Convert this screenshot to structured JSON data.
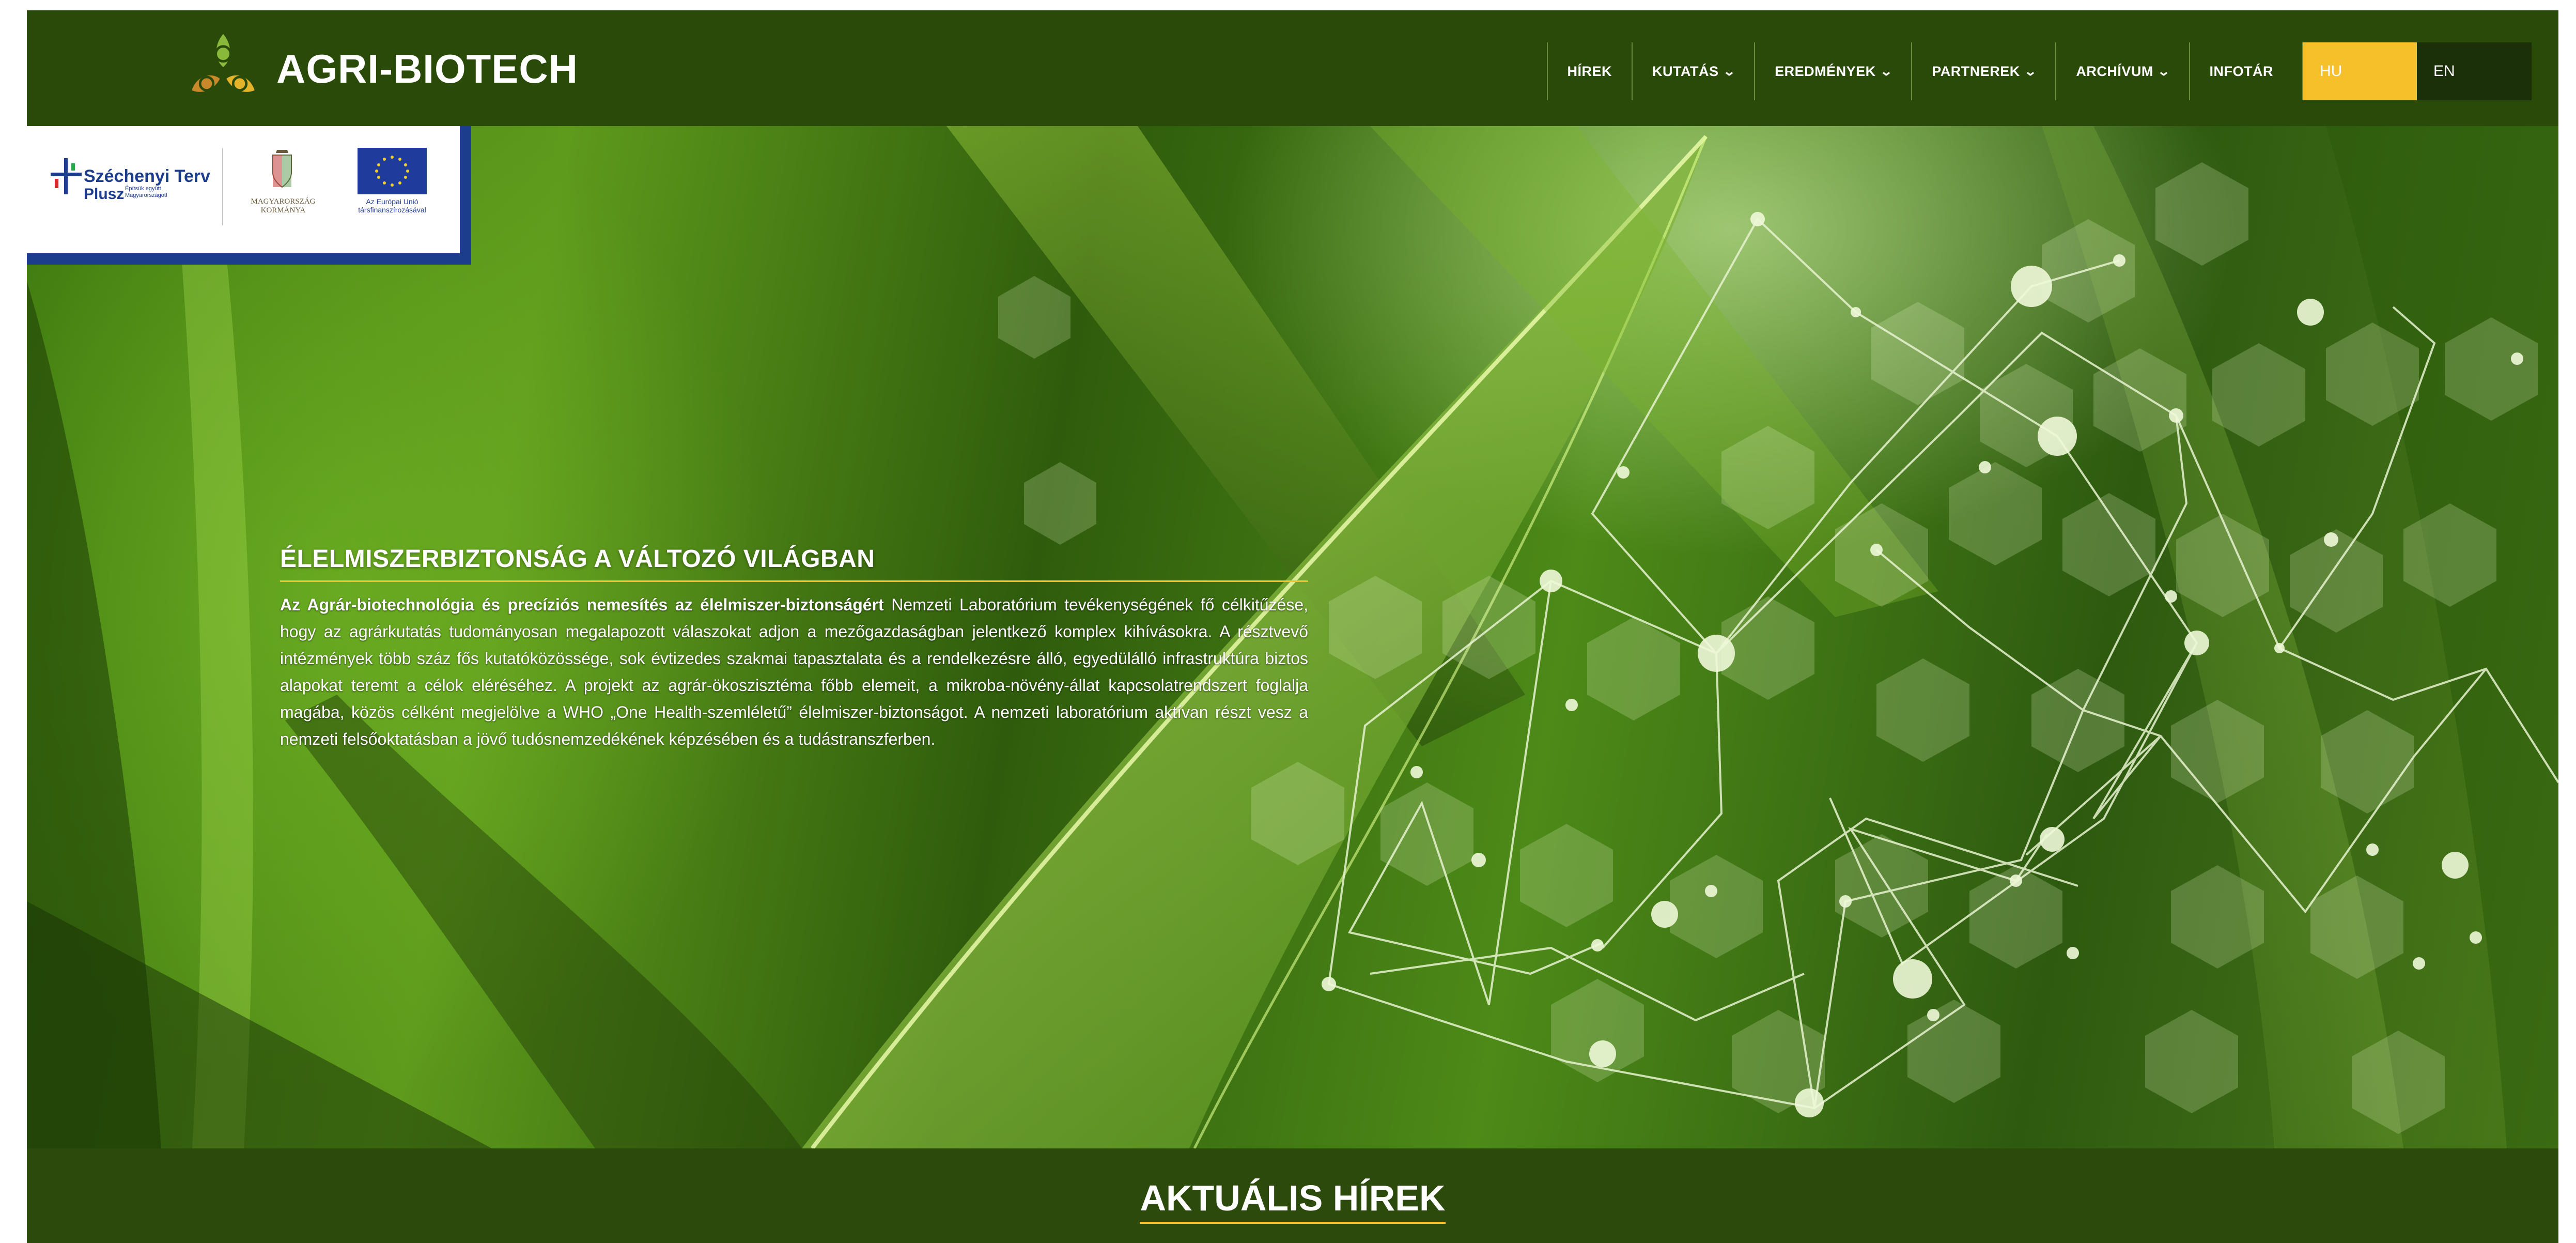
{
  "brand": {
    "name": "AGRI-BIOTECH",
    "logo_icon": "leaf-spiral-logo"
  },
  "nav": {
    "items": [
      {
        "label": "HÍREK",
        "has_dropdown": false
      },
      {
        "label": "KUTATÁS",
        "has_dropdown": true
      },
      {
        "label": "EREDMÉNYEK",
        "has_dropdown": true
      },
      {
        "label": "PARTNEREK",
        "has_dropdown": true
      },
      {
        "label": "ARCHÍVUM",
        "has_dropdown": true
      },
      {
        "label": "INFOTÁR",
        "has_dropdown": false
      }
    ],
    "lang_hu": "HU",
    "lang_en": "EN",
    "active_lang_color": "#f5c02a"
  },
  "funding_badge": {
    "szechenyi_title": "Széchenyi Terv",
    "szechenyi_sub": "Plusz",
    "szechenyi_tiny": "Építsük együtt Magyarországot!",
    "gov_text": "MAGYARORSZÁG KORMÁNYA",
    "eu_text": "Az Európai Unió társfinanszírozásával"
  },
  "intro": {
    "title": "ÉLELMISZERBIZTONSÁG A VÁLTOZÓ VILÁGBAN",
    "lead": "Az Agrár-biotechnológia és precíziós nemesítés az élelmiszer-biztonságért",
    "body": " Nemzeti Laboratórium tevékenységének fő célkitűzése, hogy az agrárkutatás tudományosan megalapozott válaszokat adjon a mezőgazdaságban jelentkező komplex kihívásokra. A résztvevő intézmények több száz fős kutatóközössége, sok évtizedes szakmai tapasztalata és a rendelkezésre álló, egyedülálló infrastruktúra biztos alapokat teremt a célok eléréséhez. A projekt az agrár-ökoszisztéma főbb elemeit, a mikroba-növény-állat kapcsolatrendszert foglalja magába, közös célként megjelölve a WHO „One Health-szemléletű” élelmiszer-biztonságot. A nemzeti laboratórium aktívan részt vesz a nemzeti felsőoktatásban a jövő tudósnemzedékének képzésében és a tudástranszferben."
  },
  "news": {
    "title": "AKTUÁLIS HÍREK"
  },
  "colors": {
    "brand_green": "#2b4a0b",
    "accent_yellow": "#f5c02a",
    "badge_blue": "#1c3c8c"
  }
}
